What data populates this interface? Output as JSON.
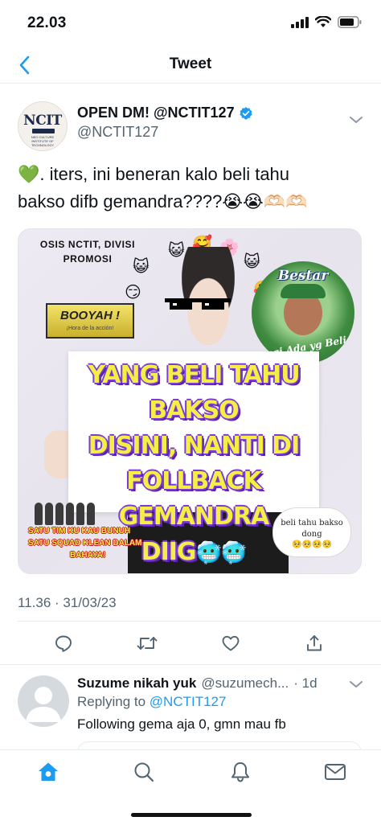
{
  "status_bar": {
    "time": "22.03"
  },
  "nav": {
    "title": "Tweet"
  },
  "tweet": {
    "author_name": "OPEN DM! @NCTIT127",
    "author_handle": "@NCTIT127",
    "avatar_logo": "NCIT",
    "avatar_subtext": "NEO CULTURE INSTITUTE OF TECHNOLOGY",
    "text_line1": "💚. iters, ini beneran kalo beli tahu",
    "text_line2": "bakso difb gemandra????😭😭🫶🏻🫶🏻",
    "timestamp": "11.36 · 31/03/23"
  },
  "media": {
    "osis_label": "OSIS NCTIT, DIVISI PROMOSI",
    "booyah_text": "BOOYAH !",
    "booyah_subtext": "¡Hora de la acción!",
    "bestar_title": "Bestar",
    "bestar_caption": "Lagi Ada yg Beli",
    "sign_line1": "YANG BELI TAHU BAKSO",
    "sign_line2": "DISINI, NANTI DI",
    "sign_line3": "FOLLBACK GEMANDRA",
    "sign_line4": "DIIG",
    "sign_emoji": "🥶🥶",
    "squad_line1": "SATU TIM KU KAU BUNUH",
    "squad_line2": "SATU SQUAD KLEAN DALAM",
    "squad_line3": "BAHAYA!",
    "bubble_text": "beli tahu bakso dong",
    "bubble_emoji": "🥺🥺🥺🥺"
  },
  "reply": {
    "author_name": "Suzume nikah yuk",
    "author_handle": "@suzumech...",
    "time": "· 1d",
    "replying_to_label": "Replying to",
    "replying_to_mention": "@NCTIT127",
    "text": "Following gema aja 0, gmn mau fb"
  },
  "icons": {
    "back": "chevron-left-icon",
    "verified": "verified-badge-icon",
    "caret": "chevron-down-icon",
    "reply": "reply-icon",
    "retweet": "retweet-icon",
    "like": "heart-icon",
    "share": "share-icon",
    "home": "home-icon",
    "search": "search-icon",
    "notifications": "bell-icon",
    "messages": "mail-icon"
  },
  "colors": {
    "accent": "#1d9bf0",
    "secondary_text": "#536471",
    "sign_text": "#f4ef44",
    "sign_outline": "#7b3bd4"
  }
}
